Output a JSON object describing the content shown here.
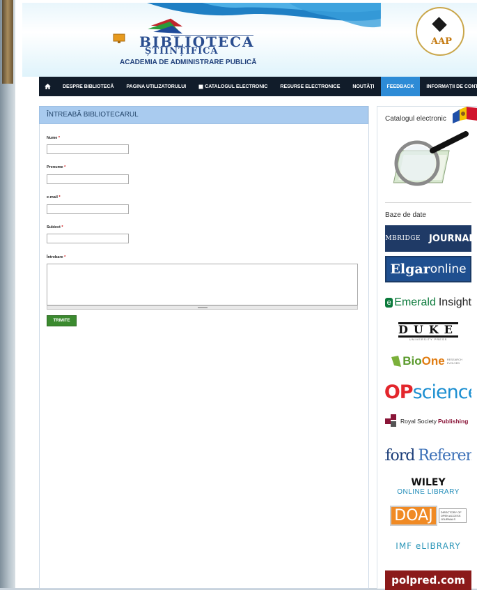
{
  "header": {
    "logo_line1": "BIBLIOTECA",
    "logo_line2": "ȘTIINȚIFICĂ",
    "logo_line3": "ACADEMIA DE ADMINISTRARE PUBLICĂ",
    "seal_text": "AAP"
  },
  "nav": {
    "items": [
      {
        "label": "DESPRE BIBLIOTECĂ"
      },
      {
        "label": "PAGINA UTILIZATORULUI"
      },
      {
        "label": "CATALOGUL ELECTRONIC"
      },
      {
        "label": "RESURSE ELECTRONICE"
      },
      {
        "label": "NOUTĂȚI"
      },
      {
        "label": "FEEDBACK"
      },
      {
        "label": "INFORMAȚII DE CONTACT"
      }
    ],
    "active": "FEEDBACK"
  },
  "form": {
    "title": "ÎNTREABĂ BIBLIOTECARUL",
    "fields": [
      {
        "label": "Nume",
        "required": "*",
        "value": ""
      },
      {
        "label": "Prenume",
        "required": "*",
        "value": ""
      },
      {
        "label": "e-mail",
        "required": "*",
        "value": ""
      },
      {
        "label": "Subiect",
        "required": "*",
        "value": ""
      }
    ],
    "question_label": "Întrebare",
    "question_required": "*",
    "question_value": "",
    "submit_label": "TRIMITE"
  },
  "sidebar": {
    "catalog_label": "Catalogul electronic",
    "databases_label": "Baze de date",
    "databases": {
      "cambridge_a": "CAMBRIDGE",
      "cambridge_b": "JOURNALS",
      "elgar_a": "Elgar",
      "elgar_b": "online",
      "emerald_a": "Emerald",
      "emerald_b": "Insight",
      "duke_a": "DUKE",
      "duke_b": "UNIVERSITY PRESS",
      "bioone_a": "Bio",
      "bioone_b": "One",
      "bioone_c": "RESEARCH EVOLVED",
      "iop_a": "IOP",
      "iop_b": "science",
      "royal_a": "Royal Society",
      "royal_b": "Publishing",
      "oxford_a": "Oxford",
      "oxford_b": "Reference",
      "wiley_a": "WILEY",
      "wiley_b": "ONLINE LIBRARY",
      "doaj_a": "DOAJ",
      "doaj_b": "DIRECTORY OF OPEN ACCESS JOURNALS",
      "imf_a": "IMF eLIBRARY",
      "polpred_a": "polpred.com"
    }
  },
  "colors": {
    "nav_bg": "#111c2a",
    "nav_active": "#2d8bd6",
    "panel_head": "#a9cbef",
    "submit": "#3b8a2f"
  }
}
